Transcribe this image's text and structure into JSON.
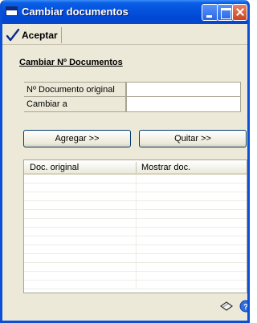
{
  "window": {
    "title": "Cambiar documentos",
    "titlebar_color": "#0551dc",
    "border_color": "#0a4fd6"
  },
  "toolbar": {
    "accept_label": "Aceptar",
    "accept_icon": "checkmark-icon"
  },
  "form": {
    "section_title": "Cambiar Nº Documentos",
    "fields": [
      {
        "label": "Nº Documento original",
        "value": ""
      },
      {
        "label": "Cambiar a",
        "value": ""
      }
    ]
  },
  "actions": {
    "add_label": "Agregar >>",
    "remove_label": "Quitar >>"
  },
  "grid": {
    "columns": [
      "Doc. original",
      "Mostrar doc."
    ],
    "rows": []
  },
  "footer": {
    "icons": [
      "note-icon",
      "help-icon"
    ]
  }
}
